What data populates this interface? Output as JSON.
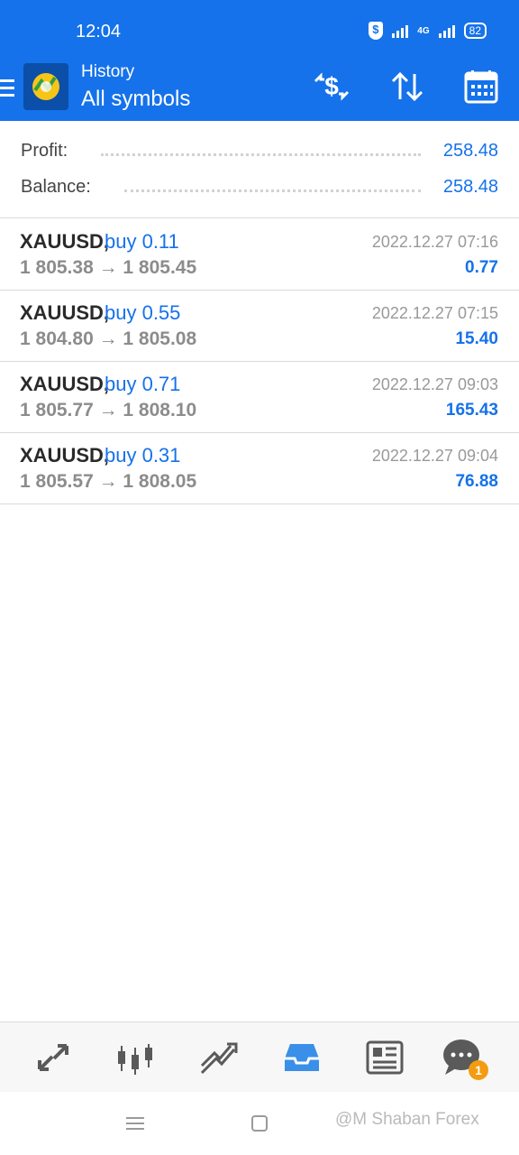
{
  "status_bar": {
    "time": "12:04",
    "network": "4G",
    "battery": "82"
  },
  "toolbar": {
    "title": "History",
    "subtitle": "All symbols",
    "icons": [
      "menu-icon",
      "metatrader-app-icon",
      "currency-exchange-icon",
      "sort-icon",
      "calendar-icon"
    ]
  },
  "summary": {
    "profit_label": "Profit:",
    "profit_value": "258.48",
    "balance_label": "Balance:",
    "balance_value": "258.48"
  },
  "trades": [
    {
      "symbol": "XAUUSD,",
      "side": "buy 0.11",
      "prices": "1 805.38 → 1 805.45",
      "datetime": "2022.12.27 07:16",
      "profit": "0.77"
    },
    {
      "symbol": "XAUUSD,",
      "side": "buy 0.55",
      "prices": "1 804.80 → 1 805.08",
      "datetime": "2022.12.27 07:15",
      "profit": "15.40"
    },
    {
      "symbol": "XAUUSD,",
      "side": "buy 0.71",
      "prices": "1 805.77 → 1 808.10",
      "datetime": "2022.12.27 09:03",
      "profit": "165.43"
    },
    {
      "symbol": "XAUUSD,",
      "side": "buy 0.31",
      "prices": "1 805.57 → 1 808.05",
      "datetime": "2022.12.27 09:04",
      "profit": "76.88"
    }
  ],
  "bottom_nav": {
    "items": [
      "quotes-icon",
      "chart-icon",
      "trade-icon",
      "history-icon",
      "news-icon",
      "chat-icon"
    ],
    "active": "history-icon",
    "chat_badge": "1"
  },
  "watermark": "@M Shaban Forex",
  "colors": {
    "accent": "#1572ea",
    "active_nav": "#3a8fe8",
    "inactive_nav": "#5a5a5a",
    "badge": "#f39c12"
  }
}
